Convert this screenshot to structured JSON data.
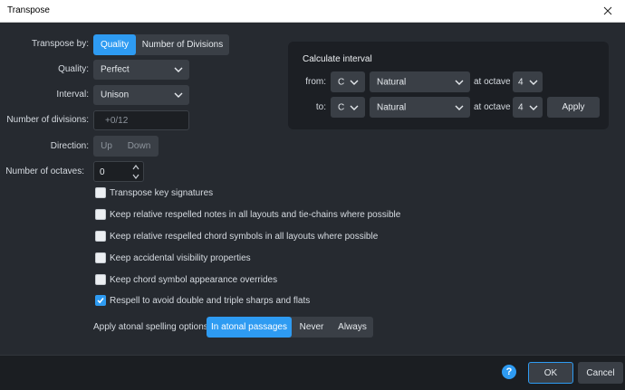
{
  "window": {
    "title": "Transpose"
  },
  "labels": {
    "transpose_by": "Transpose by:",
    "quality": "Quality:",
    "interval": "Interval:",
    "num_divisions": "Number of divisions:",
    "direction": "Direction:",
    "num_octaves": "Number of octaves:"
  },
  "transpose_by": {
    "options": [
      "Quality",
      "Number of Divisions"
    ],
    "selected": "Quality"
  },
  "quality_dropdown": {
    "value": "Perfect"
  },
  "interval_dropdown": {
    "value": "Unison"
  },
  "divisions_field": {
    "placeholder": "+0/12"
  },
  "direction": {
    "options": [
      "Up",
      "Down"
    ]
  },
  "octaves_spinner": {
    "value": "0"
  },
  "checkboxes": [
    {
      "label": "Transpose key signatures",
      "checked": false
    },
    {
      "label": "Keep relative respelled notes in all layouts and tie-chains where possible",
      "checked": false
    },
    {
      "label": "Keep relative respelled chord symbols in all layouts where possible",
      "checked": false
    },
    {
      "label": "Keep accidental visibility properties",
      "checked": false
    },
    {
      "label": "Keep chord symbol appearance overrides",
      "checked": false
    },
    {
      "label": "Respell to avoid double and triple sharps and flats",
      "checked": true
    }
  ],
  "atonal": {
    "label": "Apply atonal spelling options:",
    "options": [
      "In atonal passages",
      "Never",
      "Always"
    ],
    "selected": "In atonal passages"
  },
  "calculate": {
    "title": "Calculate interval",
    "from_label": "from:",
    "to_label": "to:",
    "at_octave_label": "at octave",
    "from": {
      "note": "C",
      "accidental": "Natural",
      "octave": "4"
    },
    "to": {
      "note": "C",
      "accidental": "Natural",
      "octave": "4"
    },
    "apply_label": "Apply"
  },
  "footer": {
    "help": "?",
    "ok": "OK",
    "cancel": "Cancel"
  },
  "colors": {
    "accent": "#2e9bf2",
    "background": "#262a30",
    "panel": "#1c1f24",
    "control": "#3a3f46"
  }
}
